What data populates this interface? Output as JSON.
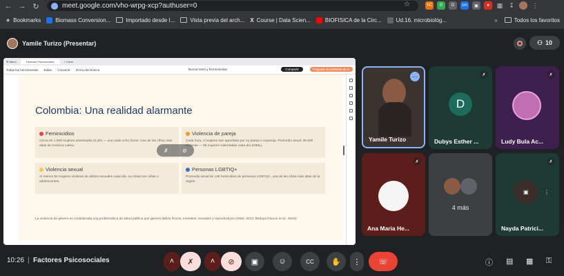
{
  "browser": {
    "url": "meet.google.com/vho-wrpg-xcp?authuser=0",
    "extensions": [
      {
        "label": "SC",
        "color": "#e8710a"
      },
      {
        "label": "G",
        "color": "#34a853"
      },
      {
        "label": "G",
        "color": "#5f6368"
      },
      {
        "label": "zm",
        "color": "#1a73e8"
      },
      {
        "label": "▣",
        "color": "#5f6368"
      },
      {
        "label": "●",
        "color": "#d93025"
      }
    ],
    "bookmarks": [
      {
        "label": "Bookmarks",
        "icon": "star-icon"
      },
      {
        "label": "Biomass Conversion...",
        "icon": "site-icon"
      },
      {
        "label": "Importado desde I...",
        "icon": "folder-icon"
      },
      {
        "label": "Vista previa del arch...",
        "icon": "folder-icon"
      },
      {
        "label": "Course | Data Scien...",
        "icon": "x-icon"
      },
      {
        "label": "BIOFISICA de la Circ...",
        "icon": "youtube-icon"
      },
      {
        "label": "Ud.16. microbiológ...",
        "icon": "site-icon"
      }
    ],
    "all_bookmarks": "Todos los favoritos"
  },
  "meet": {
    "presenter_label": "Yamile Turizo (Presentar)",
    "participant_count": "10",
    "time": "10:26",
    "separator": "|",
    "meeting_name": "Factores Psicosociales"
  },
  "shared_doc": {
    "tab_label": "Factores Psicosociales",
    "tab_new": "+ Crear",
    "menu": [
      "Todas las herramientas",
      "Editar",
      "Convertir",
      "Firma electrónica"
    ],
    "search_label": "Buscar texto y herramientas",
    "share_button": "Compartir",
    "ask_button": "Pregunte al Asistente de IA",
    "title": "Colombia: Una realidad alarmante",
    "cards": [
      {
        "title": "Feminicidios",
        "dot_color": "#e8453c",
        "body": "Cerca de 1.000 mujeres asesinadas al año — una cada ocho horas. Una de las cifras más altas de América Latina."
      },
      {
        "title": "Violencia de pareja",
        "dot_color": "#f29a1f",
        "body": "Cada hora, 4 mujeres son agredidas por su pareja o expareja. Promedio anual: 35.000 víctimas — 96 mujeres violentadas cada día (INML)."
      },
      {
        "title": "Violencia sexual",
        "dot_color": "#f7c948",
        "body": "Al menos 54 mujeres víctimas de delitos sexuales cada día. La mitad son niñas o adolescentes."
      },
      {
        "title": "Personas LGBTIQ+",
        "dot_color": "#2f6fd6",
        "body": "Promedio anual de 139 homicidios de personas LGBTIQ+, una de las cifras más altas de la región."
      }
    ],
    "footnote": "La violencia de género es considerada una problemática de salud pública que genera daños físicos, mentales, sexuales y reproductivos (OMS, 2013; Bedoya Paucar et al., 2020)."
  },
  "participants": [
    {
      "name": "Yamile Turizo",
      "type": "video",
      "bg": "#3b3330"
    },
    {
      "name": "Dubys Esther ...",
      "type": "initial",
      "initial": "D",
      "bg": "#1e3a35",
      "avatar_bg": "#1d6b5a"
    },
    {
      "name": "Ludy Bula Ac...",
      "type": "photo",
      "bg": "#3f1f4d"
    },
    {
      "name": "Ana Maria He...",
      "type": "photo",
      "bg": "#5c1e1a"
    },
    {
      "name": "",
      "type": "more",
      "label": "4 más",
      "bg": "#3c4043"
    },
    {
      "name": "Nayda Patrici...",
      "type": "photo",
      "bg": "#1e3a35"
    }
  ],
  "controls": {
    "mic": "microphone-off",
    "camera": "camera-off",
    "present": "present-screen",
    "emoji": "emoji",
    "captions": "CC",
    "hand": "raise-hand",
    "more": "more",
    "end": "end-call"
  }
}
